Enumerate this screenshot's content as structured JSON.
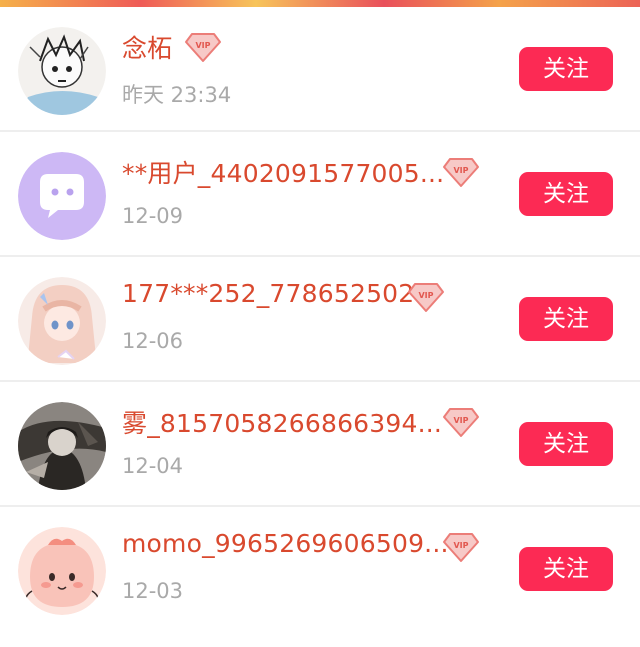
{
  "users": [
    {
      "name": "念柘",
      "date": "昨天 23:34",
      "vip": true,
      "follow_label": "关注",
      "avatar": "anime-sketch-avatar"
    },
    {
      "name": "**用户_4402091577005...",
      "date": "12-09",
      "vip": true,
      "follow_label": "关注",
      "avatar": "default-chat-avatar"
    },
    {
      "name": "177***252_778652502",
      "date": "12-06",
      "vip": true,
      "follow_label": "关注",
      "avatar": "anime-girl-avatar"
    },
    {
      "name": "雾_8157058266866394...",
      "date": "12-04",
      "vip": true,
      "follow_label": "关注",
      "avatar": "dark-anime-avatar"
    },
    {
      "name": "momo_9965269606509...",
      "date": "12-03",
      "vip": true,
      "follow_label": "关注",
      "avatar": "peach-character-avatar"
    }
  ],
  "colors": {
    "name": "#d9492e",
    "date": "#a9a9a9",
    "follow_button": "#fc2a54",
    "divider": "#eeeeee"
  }
}
